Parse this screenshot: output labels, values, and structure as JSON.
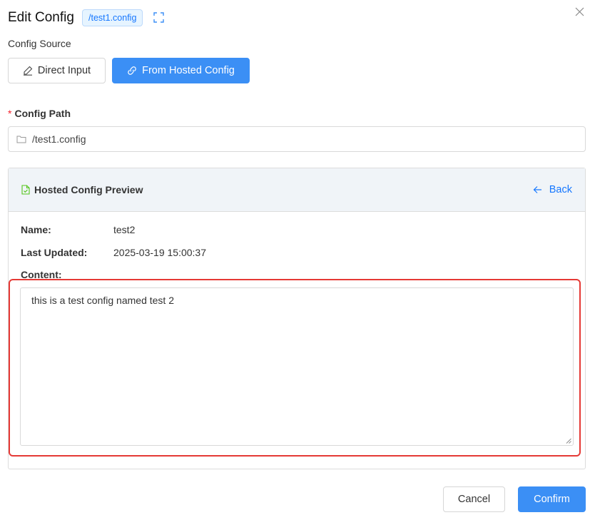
{
  "dialog": {
    "title": "Edit Config",
    "path_tag": "/test1.config"
  },
  "source": {
    "label": "Config Source",
    "direct_label": "Direct Input",
    "hosted_label": "From Hosted Config",
    "selected": "From Hosted Config"
  },
  "config_path": {
    "required_mark": "*",
    "label": "Config Path",
    "value": "/test1.config"
  },
  "preview": {
    "title": "Hosted Config Preview",
    "back_label": "Back",
    "name_key": "Name:",
    "name_value": "test2",
    "updated_key": "Last Updated:",
    "updated_value": "2025-03-19 15:00:37",
    "content_key": "Content:",
    "content_value": "this is a test config named test 2"
  },
  "footer": {
    "cancel_label": "Cancel",
    "confirm_label": "Confirm"
  },
  "colors": {
    "accent": "#3b8ff5",
    "link": "#1677ff",
    "required": "#f5222d",
    "highlight_border": "#e53935",
    "preview_header_bg": "#f0f4f8"
  },
  "icons": {
    "expand": "expand-icon",
    "close": "close-icon",
    "direct": "pencil-icon",
    "hosted": "link-icon",
    "path": "folder-icon",
    "preview": "file-check-icon",
    "back": "arrow-left-icon"
  }
}
